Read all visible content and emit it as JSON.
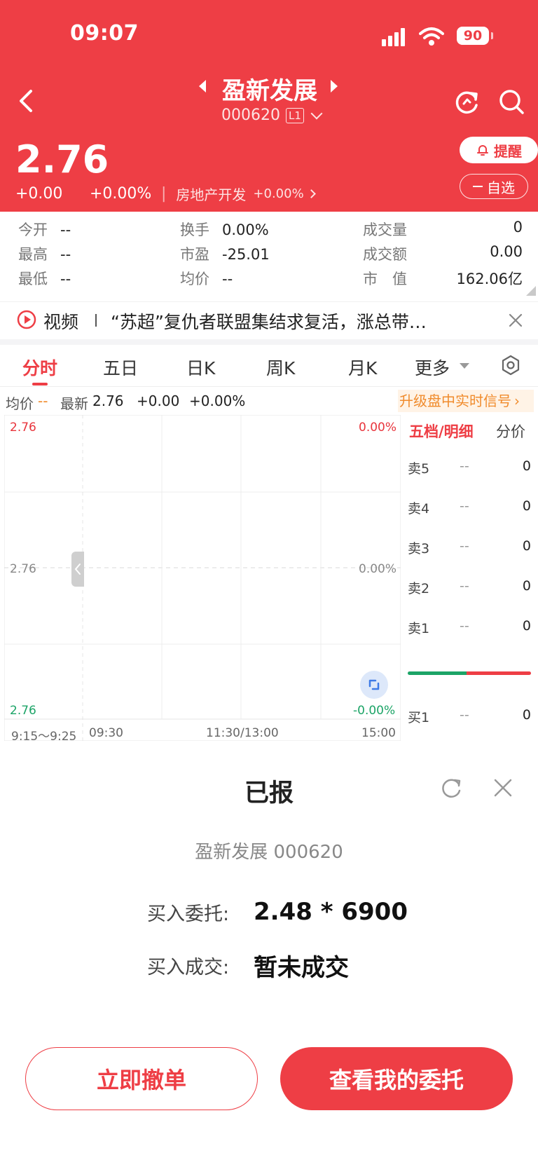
{
  "status_bar": {
    "time": "09:07",
    "battery": "90"
  },
  "header": {
    "title": "盈新发展",
    "code": "000620",
    "level_badge": "L1",
    "price": "2.76",
    "change": "+0.00",
    "change_pct": "+0.00%",
    "sector": "房地产开发",
    "sector_pct": "+0.00%",
    "alert_label": "提醒",
    "watchlist_label": "自选"
  },
  "stats": {
    "open": {
      "label": "今开",
      "value": "--"
    },
    "high": {
      "label": "最高",
      "value": "--"
    },
    "low": {
      "label": "最低",
      "value": "--"
    },
    "turnover": {
      "label": "换手",
      "value": "0.00%"
    },
    "pe": {
      "label": "市盈",
      "value": "-25.01"
    },
    "avg_price": {
      "label": "均价",
      "value": "--"
    },
    "volume": {
      "label": "成交量",
      "value": "0"
    },
    "amount": {
      "label": "成交额",
      "value": "0.00"
    },
    "market_cap": {
      "label": "市　值",
      "value": "162.06亿"
    }
  },
  "news": {
    "label": "视频",
    "text": "“苏超”复仇者联盟集结求复活，涨总带…"
  },
  "tabs": [
    "分时",
    "五日",
    "日K",
    "周K",
    "月K",
    "更多"
  ],
  "active_tab": 0,
  "chart_info": {
    "avg_label": "均价",
    "avg_value": "--",
    "latest_label": "最新",
    "latest_value": "2.76",
    "change": "+0.00",
    "change_pct": "+0.00%",
    "upgrade_label": "升级盘中实时信号"
  },
  "chart_data": {
    "type": "line",
    "y_left_labels": [
      "2.76",
      "2.76",
      "2.76"
    ],
    "y_right_labels": [
      "0.00%",
      "0.00%",
      "-0.00%"
    ],
    "x_labels": [
      "9:15～9:25",
      "09:30",
      "11:30/13:00",
      "15:00"
    ],
    "series": []
  },
  "order_book": {
    "tab_depth": "五档/明细",
    "tab_price": "分价",
    "asks": [
      {
        "label": "卖5",
        "price": "--",
        "volume": "0"
      },
      {
        "label": "卖4",
        "price": "--",
        "volume": "0"
      },
      {
        "label": "卖3",
        "price": "--",
        "volume": "0"
      },
      {
        "label": "卖2",
        "price": "--",
        "volume": "0"
      },
      {
        "label": "卖1",
        "price": "--",
        "volume": "0"
      }
    ],
    "bids": [
      {
        "label": "买1",
        "price": "--",
        "volume": "0"
      }
    ]
  },
  "modal": {
    "title": "已报",
    "stock": "盈新发展 000620",
    "order_label": "买入委托:",
    "order_value": "2.48 * 6900",
    "fill_label": "买入成交:",
    "fill_value": "暂未成交",
    "cancel_button": "立即撤单",
    "view_button": "查看我的委托"
  },
  "colors": {
    "brand_red": "#EE3E45",
    "up_red": "#E8343C",
    "down_green": "#1CA467",
    "orange": "#F08B2C"
  }
}
